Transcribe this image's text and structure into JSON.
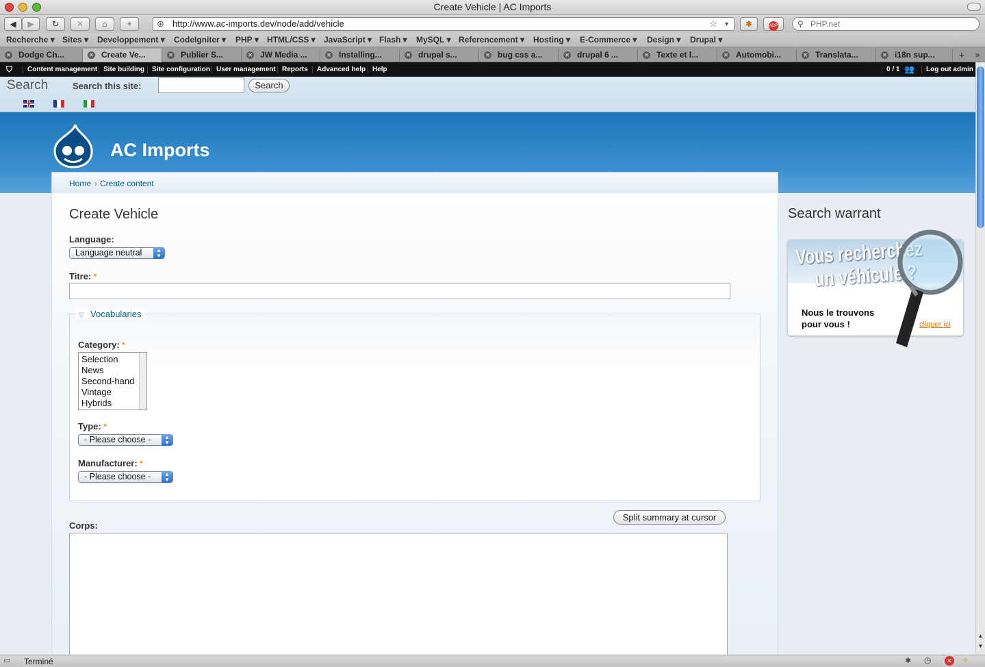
{
  "window": {
    "title": "Create Vehicle | AC Imports"
  },
  "browser": {
    "url": "http://www.ac-imports.dev/node/add/vehicle",
    "search_placeholder": "PHP.net",
    "bookmarks": [
      "Recherche",
      "Sites",
      "Developpement",
      "CodeIgniter",
      "PHP",
      "HTML/CSS",
      "JavaScript",
      "Flash",
      "MySQL",
      "Referencement",
      "Hosting",
      "E-Commerce",
      "Design",
      "Drupal"
    ],
    "tabs": [
      "Dodge Ch...",
      "Create Ve...",
      "Publier S...",
      "JW Media ...",
      "Installing...",
      "drupal s...",
      "bug css a...",
      "drupal 6 ...",
      "Texte et l...",
      "Automobi...",
      "Translata...",
      "i18n sup..."
    ],
    "active_tab": 1,
    "status": "Terminé"
  },
  "admin_menu": {
    "items": [
      "Content management",
      "Site building",
      "Site configuration",
      "User management",
      "Reports",
      "Advanced help",
      "Help"
    ],
    "users_count": "0 / 1",
    "logout": "Log out admin"
  },
  "site_search": {
    "title": "Search",
    "label": "Search this site:",
    "value": "",
    "button": "Search"
  },
  "languages": [
    "en-flag-icon",
    "fr-flag-icon",
    "it-flag-icon"
  ],
  "site": {
    "name": "AC Imports"
  },
  "breadcrumb": {
    "home": "Home",
    "separator": "›",
    "current": "Create content"
  },
  "page": {
    "title": "Create Vehicle"
  },
  "form": {
    "language": {
      "label": "Language:",
      "value": "Language neutral"
    },
    "titre": {
      "label": "Titre:",
      "required": "*",
      "value": ""
    },
    "vocabularies": {
      "legend": "Vocabularies",
      "category": {
        "label": "Category:",
        "required": "*",
        "options": [
          "Selection",
          "News",
          "Second-hand",
          "Vintage",
          "Hybrids"
        ]
      },
      "type": {
        "label": "Type:",
        "required": "*",
        "value": "- Please choose -"
      },
      "manufacturer": {
        "label": "Manufacturer:",
        "required": "*",
        "value": "- Please choose -"
      }
    },
    "split_button": "Split summary at cursor",
    "corps": {
      "label": "Corps:",
      "value": ""
    }
  },
  "sidebar": {
    "block_title": "Search warrant",
    "banner": {
      "headline1": "Vous recherchez",
      "headline2": "un véhicule ?",
      "line1": "Nous le trouvons",
      "line2": "pour vous !",
      "link": "cliquer ici"
    }
  },
  "colors": {
    "accent": "#0062a0",
    "header_blue": "#2b82c6",
    "required": "#f7941e"
  }
}
